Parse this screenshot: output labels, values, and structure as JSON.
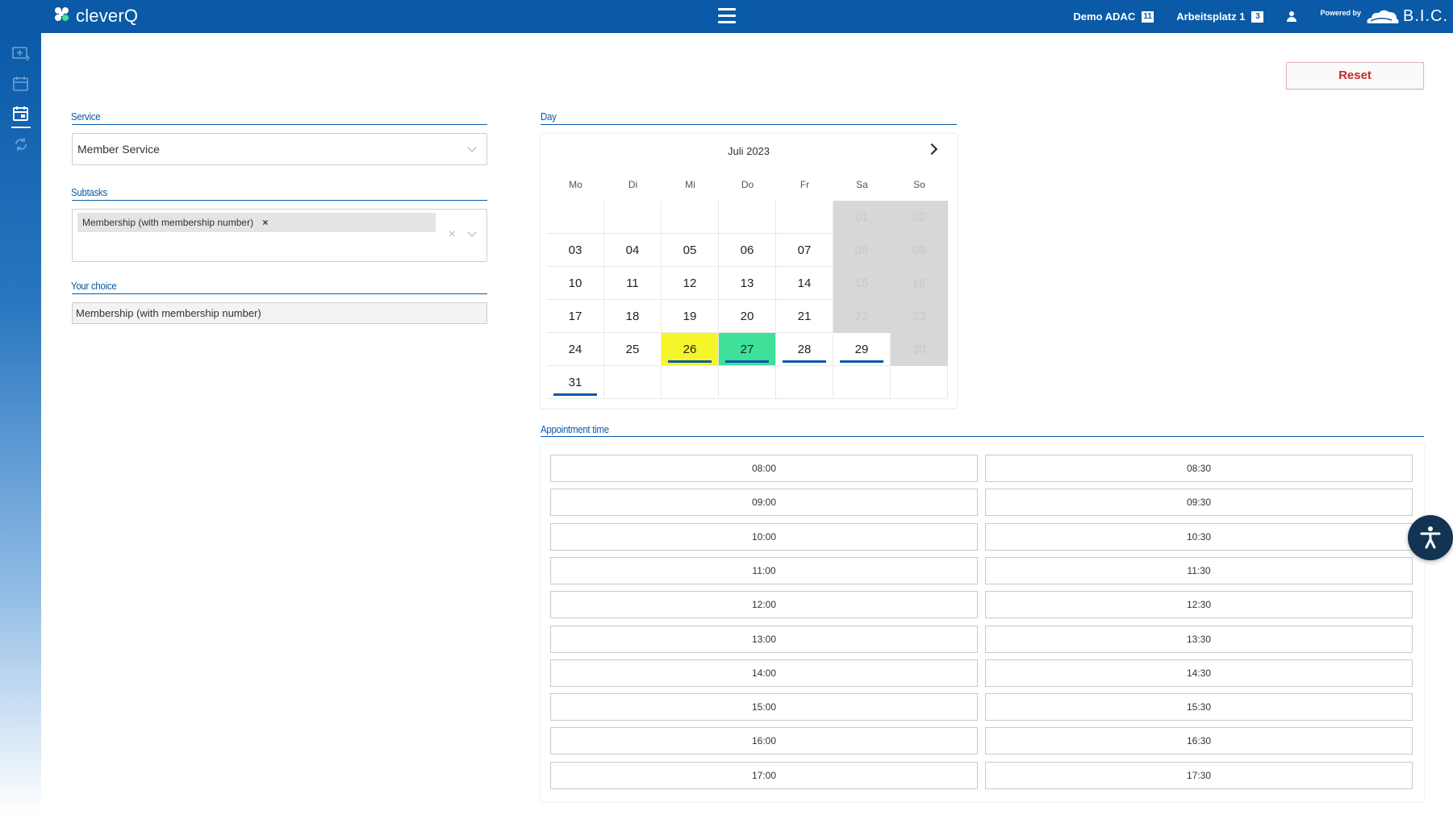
{
  "header": {
    "app_name": "cleverQ",
    "org": "Demo ADAC",
    "org_badge": "11",
    "workplace": "Arbeitsplatz 1",
    "workplace_badge": "3",
    "powered_by": "Powered by",
    "brand": "B.I.C.",
    "brand_color": "#0a5aa8"
  },
  "sidebar": {
    "items": [
      {
        "icon": "add-ticket-icon"
      },
      {
        "icon": "calendar-icon"
      },
      {
        "icon": "calendar-today-icon",
        "active": true
      },
      {
        "icon": "sync-icon"
      }
    ]
  },
  "actions": {
    "reset_label": "Reset"
  },
  "form": {
    "service_label": "Service",
    "service_value": "Member Service",
    "subtasks_label": "Subtasks",
    "subtask_chip": "Membership (with membership number)",
    "subtask_chip_remove": "×",
    "clear_icon": "×",
    "choice_label": "Your choice",
    "choice_value": "Membership (with membership number)"
  },
  "calendar": {
    "label": "Day",
    "month": "Juli 2023",
    "weekdays": [
      "Mo",
      "Di",
      "Mi",
      "Do",
      "Fr",
      "Sa",
      "So"
    ],
    "weeks": [
      [
        null,
        null,
        null,
        null,
        null,
        {
          "d": "01",
          "state": "disabled"
        },
        {
          "d": "02",
          "state": "disabled"
        }
      ],
      [
        {
          "d": "03"
        },
        {
          "d": "04"
        },
        {
          "d": "05"
        },
        {
          "d": "06"
        },
        {
          "d": "07"
        },
        {
          "d": "08",
          "state": "disabled"
        },
        {
          "d": "09",
          "state": "disabled"
        }
      ],
      [
        {
          "d": "10"
        },
        {
          "d": "11"
        },
        {
          "d": "12"
        },
        {
          "d": "13"
        },
        {
          "d": "14"
        },
        {
          "d": "15",
          "state": "disabled"
        },
        {
          "d": "16",
          "state": "disabled"
        }
      ],
      [
        {
          "d": "17"
        },
        {
          "d": "18"
        },
        {
          "d": "19"
        },
        {
          "d": "20"
        },
        {
          "d": "21"
        },
        {
          "d": "22",
          "state": "disabled"
        },
        {
          "d": "23",
          "state": "disabled"
        }
      ],
      [
        {
          "d": "24"
        },
        {
          "d": "25"
        },
        {
          "d": "26",
          "state": "today",
          "available": true
        },
        {
          "d": "27",
          "state": "selected",
          "available": true
        },
        {
          "d": "28",
          "available": true
        },
        {
          "d": "29",
          "available": true
        },
        {
          "d": "30",
          "state": "disabled"
        }
      ],
      [
        {
          "d": "31",
          "available": true
        },
        null,
        null,
        null,
        null,
        null,
        null
      ]
    ],
    "colors": {
      "today": "#f5f52a",
      "selected": "#3ee09a",
      "available_marker": "#0a5aa8",
      "disabled": "#d7d7d7"
    }
  },
  "appointments": {
    "label": "Appointment time",
    "slots": [
      "08:00",
      "08:30",
      "09:00",
      "09:30",
      "10:00",
      "10:30",
      "11:00",
      "11:30",
      "12:00",
      "12:30",
      "13:00",
      "13:30",
      "14:00",
      "14:30",
      "15:00",
      "15:30",
      "16:00",
      "16:30",
      "17:00",
      "17:30"
    ]
  },
  "accessibility": {
    "icon": "accessibility-icon",
    "color": "#133353"
  }
}
